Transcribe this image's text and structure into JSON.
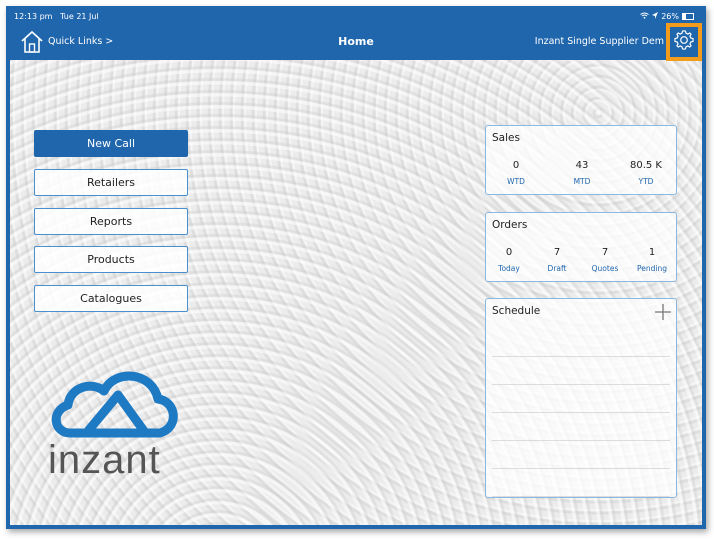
{
  "status": {
    "time": "12:13 pm",
    "date": "Tue 21 Jul",
    "battery": "26%"
  },
  "nav": {
    "quick_links": "Quick Links >",
    "title": "Home",
    "supplier": "Inzant Single Supplier Dem"
  },
  "menu": [
    "New Call",
    "Retailers",
    "Reports",
    "Products",
    "Catalogues"
  ],
  "sales": {
    "title": "Sales",
    "stats": [
      {
        "value": "0",
        "label": "WTD"
      },
      {
        "value": "43",
        "label": "MTD"
      },
      {
        "value": "80.5 K",
        "label": "YTD"
      }
    ]
  },
  "orders": {
    "title": "Orders",
    "stats": [
      {
        "value": "0",
        "label": "Today"
      },
      {
        "value": "7",
        "label": "Draft"
      },
      {
        "value": "7",
        "label": "Quotes"
      },
      {
        "value": "1",
        "label": "Pending"
      }
    ]
  },
  "schedule": {
    "title": "Schedule"
  },
  "logo": {
    "text": "inzant"
  },
  "colors": {
    "primary": "#1f66ad",
    "highlight": "#f29b1d",
    "card_border": "#8ab8e0"
  }
}
